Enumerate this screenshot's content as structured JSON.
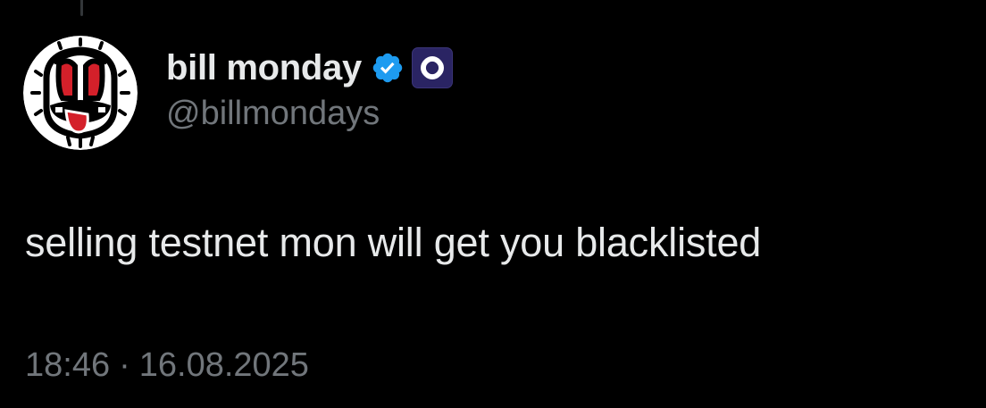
{
  "tweet": {
    "author": {
      "display_name": "bill monday",
      "handle": "@billmondays",
      "avatar_icon": "tiki-mask-avatar-icon",
      "verified_icon": "verified-badge-icon",
      "affiliate_icon": "monad-logo-icon"
    },
    "text": "selling testnet mon will get you blacklisted",
    "time": "18:46",
    "separator": "·",
    "date": "16.08.2025"
  },
  "colors": {
    "background": "#000000",
    "primary_text": "#e7e9ea",
    "secondary_text": "#71767b",
    "verified_blue": "#1d9bf0",
    "affiliate_bg": "#2a2463",
    "avatar_red": "#d4202a"
  }
}
